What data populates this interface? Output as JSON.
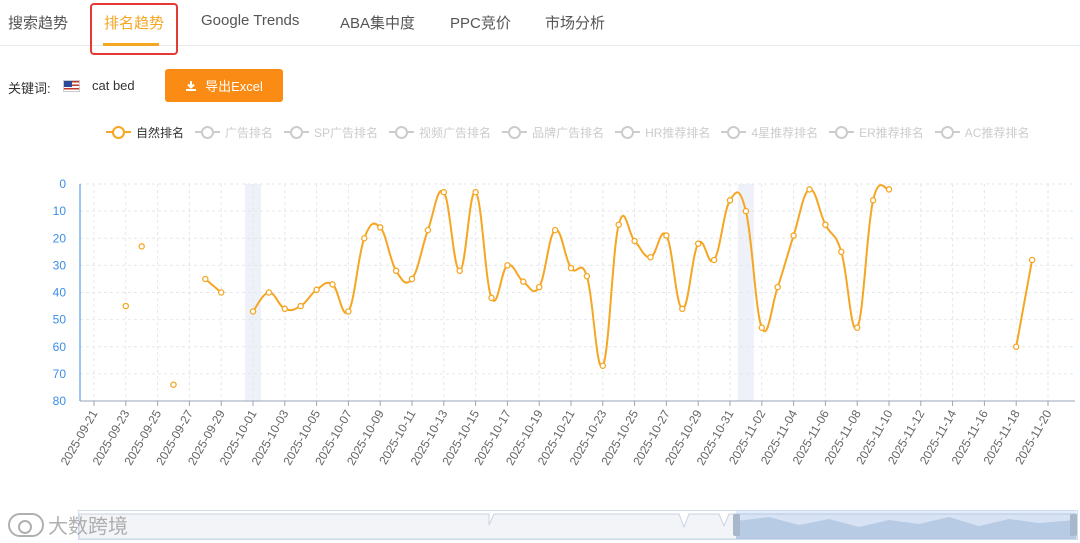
{
  "tabs": [
    {
      "label": "搜索趋势",
      "active": false
    },
    {
      "label": "排名趋势",
      "active": true
    },
    {
      "label": "Google Trends",
      "active": false
    },
    {
      "label": "ABA集中度",
      "active": false
    },
    {
      "label": "PPC竞价",
      "active": false
    },
    {
      "label": "市场分析",
      "active": false
    }
  ],
  "keyword": {
    "label": "关键词:",
    "flag_icon": "us-flag-icon",
    "value": "cat bed"
  },
  "export_button": {
    "label": "导出Excel",
    "icon": "download-icon",
    "color": "#fa8c16"
  },
  "legend": [
    {
      "label": "自然排名",
      "active": true
    },
    {
      "label": "广告排名",
      "active": false
    },
    {
      "label": "SP广告排名",
      "active": false
    },
    {
      "label": "视频广告排名",
      "active": false
    },
    {
      "label": "品牌广告排名",
      "active": false
    },
    {
      "label": "HR推荐排名",
      "active": false
    },
    {
      "label": "4星推荐排名",
      "active": false
    },
    {
      "label": "ER推荐排名",
      "active": false
    },
    {
      "label": "AC推荐排名",
      "active": false
    }
  ],
  "colors": {
    "accent": "#f5a623",
    "highlight_box": "#e53935",
    "axis_label": "#3a8ee6"
  },
  "chart_data": {
    "type": "line",
    "y_inverted": true,
    "ylim": [
      0,
      80
    ],
    "yticks": [
      0,
      10,
      20,
      30,
      40,
      50,
      60,
      70,
      80
    ],
    "grid": true,
    "legend_position": "top",
    "x_start": "2025-09-21",
    "x_end": "2025-11-20",
    "x_tick_labels": [
      "2025-09-21",
      "2025-09-23",
      "2025-09-25",
      "2025-09-27",
      "2025-09-29",
      "2025-10-01",
      "2025-10-03",
      "2025-10-05",
      "2025-10-07",
      "2025-10-09",
      "2025-10-11",
      "2025-10-13",
      "2025-10-15",
      "2025-10-17",
      "2025-10-19",
      "2025-10-21",
      "2025-10-23",
      "2025-10-25",
      "2025-10-27",
      "2025-10-29",
      "2025-10-31",
      "2025-11-02",
      "2025-11-04",
      "2025-11-06",
      "2025-11-08",
      "2025-11-10",
      "2025-11-12",
      "2025-11-14",
      "2025-11-16",
      "2025-11-18",
      "2025-11-20"
    ],
    "shaded_dates": [
      "2025-10-01",
      "2025-11-01"
    ],
    "series": [
      {
        "name": "自然排名",
        "color": "#f5a623",
        "points": [
          [
            "2025-09-23",
            45
          ],
          [
            "2025-09-24",
            23
          ],
          [
            "2025-09-26",
            74
          ],
          [
            "2025-09-28",
            35
          ],
          [
            "2025-09-29",
            40
          ],
          [
            "2025-10-01",
            47
          ],
          [
            "2025-10-02",
            40
          ],
          [
            "2025-10-03",
            46
          ],
          [
            "2025-10-04",
            45
          ],
          [
            "2025-10-05",
            39
          ],
          [
            "2025-10-06",
            37
          ],
          [
            "2025-10-07",
            47
          ],
          [
            "2025-10-08",
            20
          ],
          [
            "2025-10-09",
            16
          ],
          [
            "2025-10-10",
            32
          ],
          [
            "2025-10-11",
            35
          ],
          [
            "2025-10-12",
            17
          ],
          [
            "2025-10-13",
            3
          ],
          [
            "2025-10-14",
            32
          ],
          [
            "2025-10-15",
            3
          ],
          [
            "2025-10-16",
            42
          ],
          [
            "2025-10-17",
            30
          ],
          [
            "2025-10-18",
            36
          ],
          [
            "2025-10-19",
            38
          ],
          [
            "2025-10-20",
            17
          ],
          [
            "2025-10-21",
            31
          ],
          [
            "2025-10-22",
            34
          ],
          [
            "2025-10-23",
            67
          ],
          [
            "2025-10-24",
            15
          ],
          [
            "2025-10-25",
            21
          ],
          [
            "2025-10-26",
            27
          ],
          [
            "2025-10-27",
            19
          ],
          [
            "2025-10-28",
            46
          ],
          [
            "2025-10-29",
            22
          ],
          [
            "2025-10-30",
            28
          ],
          [
            "2025-10-31",
            6
          ],
          [
            "2025-11-01",
            10
          ],
          [
            "2025-11-02",
            53
          ],
          [
            "2025-11-03",
            38
          ],
          [
            "2025-11-04",
            19
          ],
          [
            "2025-11-05",
            2
          ],
          [
            "2025-11-06",
            15
          ],
          [
            "2025-11-07",
            25
          ],
          [
            "2025-11-08",
            53
          ],
          [
            "2025-11-09",
            6
          ],
          [
            "2025-11-10",
            2
          ],
          [
            "2025-11-18",
            60
          ],
          [
            "2025-11-19",
            28
          ]
        ],
        "connected_segments": [
          [
            "2025-09-28",
            "2025-09-29"
          ],
          [
            "2025-10-01",
            "2025-11-10"
          ],
          [
            "2025-11-18",
            "2025-11-19"
          ]
        ]
      }
    ]
  },
  "watermark": "大数跨境"
}
